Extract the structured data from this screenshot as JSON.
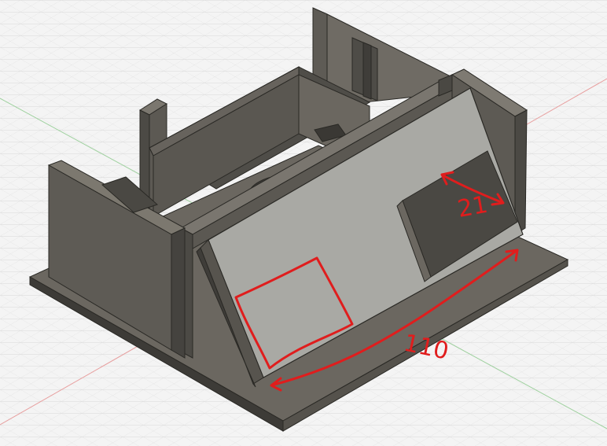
{
  "viewport": {
    "background": "#f4f4f4",
    "grid_color": "#d6d6d6",
    "axis_x_color": "#e8a0a0",
    "axis_y_color": "#9fd19f"
  },
  "model": {
    "face_color": "#a9a9a4",
    "side_color": "#5e5b55",
    "dark_color": "#4a4843",
    "edge_color": "#2a2925",
    "base_color": "#6b6760"
  },
  "annotations": {
    "color": "#e01d1d",
    "width_label": "21",
    "length_label": "110"
  }
}
